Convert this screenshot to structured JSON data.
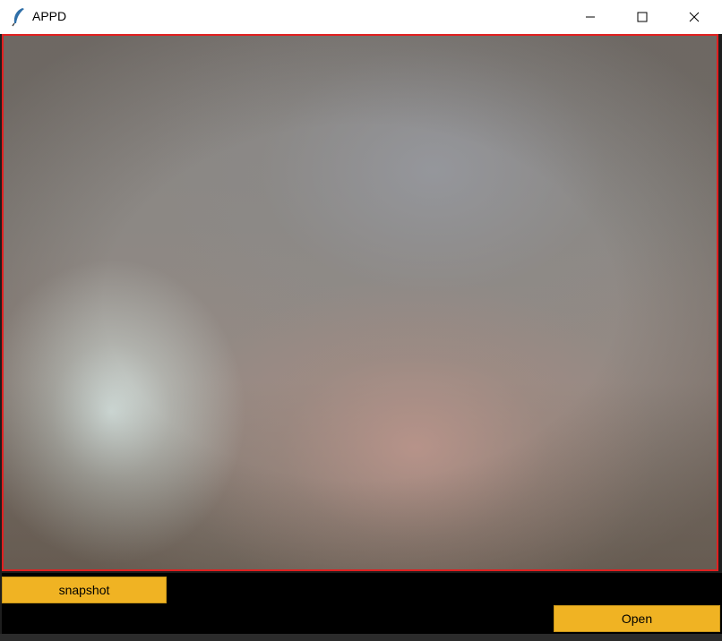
{
  "window": {
    "title": "APPD",
    "controls": [
      "minimize-icon",
      "maximize-icon",
      "close-icon"
    ]
  },
  "preview": {
    "border_color": "#e02020"
  },
  "buttons": {
    "snapshot_label": "snapshot",
    "open_label": "Open",
    "accent_color": "#f0b323"
  }
}
